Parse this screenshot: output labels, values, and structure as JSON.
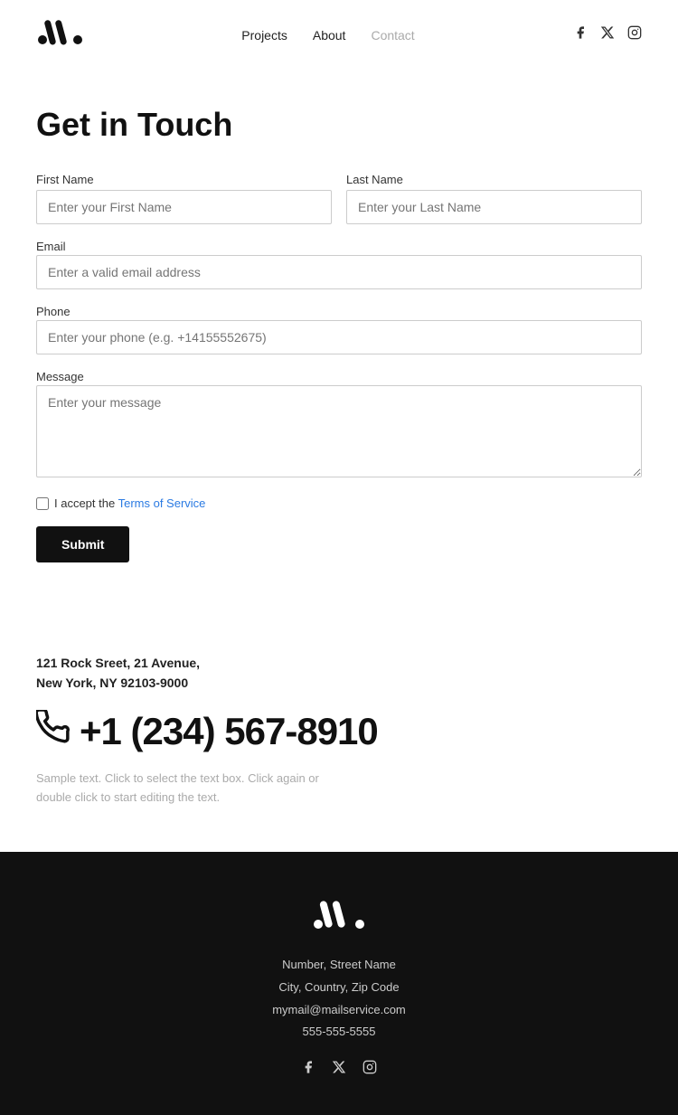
{
  "header": {
    "logo_alt": "Logo",
    "nav": [
      {
        "label": "Projects",
        "href": "#",
        "active": false
      },
      {
        "label": "About",
        "href": "#",
        "active": false
      },
      {
        "label": "Contact",
        "href": "#",
        "active": true,
        "muted": true
      }
    ],
    "social": [
      "facebook",
      "x-twitter",
      "instagram"
    ]
  },
  "page_title": "Get in Touch",
  "form": {
    "first_name_label": "First Name",
    "first_name_placeholder": "Enter your First Name",
    "last_name_label": "Last Name",
    "last_name_placeholder": "Enter your Last Name",
    "email_label": "Email",
    "email_placeholder": "Enter a valid email address",
    "phone_label": "Phone",
    "phone_placeholder": "Enter your phone (e.g. +14155552675)",
    "message_label": "Message",
    "message_placeholder": "Enter your message",
    "tos_text": "I accept the ",
    "tos_link": "Terms of Service",
    "submit_label": "Submit"
  },
  "contact": {
    "address_line1": "121 Rock Sreet, 21 Avenue,",
    "address_line2": "New York, NY 92103-9000",
    "phone": "+1 (234) 567-8910",
    "sample_text": "Sample text. Click to select the text box. Click again or double click to start editing the text."
  },
  "footer": {
    "address_line1": "Number, Street Name",
    "address_line2": "City, Country, Zip Code",
    "email": "mymail@mailservice.com",
    "phone": "555-555-5555",
    "social": [
      "facebook",
      "x-twitter",
      "instagram"
    ]
  }
}
